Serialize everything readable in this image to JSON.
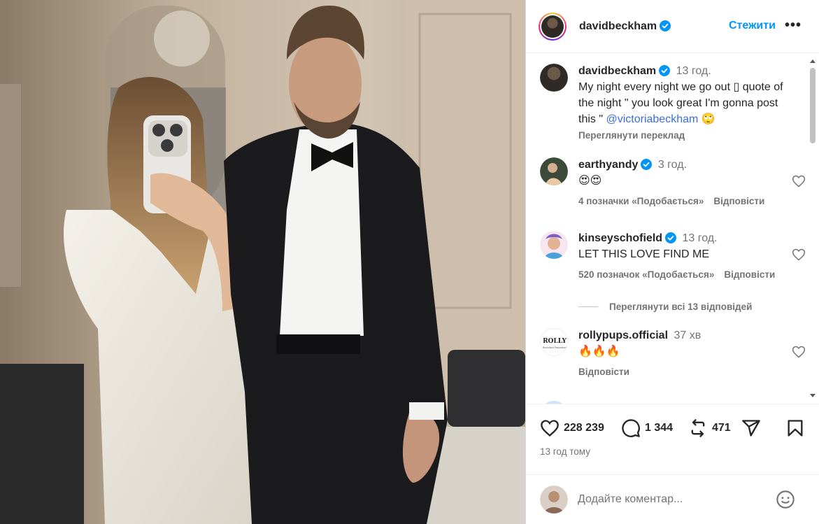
{
  "header": {
    "username": "davidbeckham",
    "follow_label": "Стежити",
    "more_label": "•••"
  },
  "caption": {
    "username": "davidbeckham",
    "time": "13 год.",
    "text": "My night every night we go out ▯ quote of the night \" you look great I'm gonna post this \" ",
    "mention": "@victoriabeckham",
    "emoji": "🙄",
    "translate_label": "Переглянути переклад"
  },
  "comments": [
    {
      "username": "earthyandy",
      "verified": true,
      "time": "3 год.",
      "text": "😍😍",
      "likes": "4 позначки «Подобається»",
      "reply": "Відповісти"
    },
    {
      "username": "kinseyschofield",
      "verified": true,
      "time": "13 год.",
      "text": "LET THIS LOVE FIND ME",
      "likes": "520 позначок «Подобається»",
      "reply": "Відповісти"
    },
    {
      "username": "rollypups.official",
      "verified": false,
      "time": "37 хв",
      "text": "🔥🔥🔥",
      "likes": "",
      "reply": "Відповісти"
    }
  ],
  "view_replies_label": "Переглянути всі 13 відповідей",
  "actions": {
    "likes": "228 239",
    "comments": "1 344",
    "reposts": "471"
  },
  "post_time": "13 год тому",
  "add_comment": {
    "placeholder": "Додайте коментар..."
  },
  "avatars": {
    "rollypups_text": "ROLLY",
    "rollypups_sub": "Recollect Paparazzi"
  },
  "colors": {
    "accent_blue": "#0095f6",
    "verified_blue": "#0095f6",
    "muted_text": "#737373"
  },
  "icons": [
    "verified-badge-icon",
    "more-options-icon",
    "heart-icon",
    "comment-icon",
    "repost-icon",
    "share-icon",
    "bookmark-icon",
    "emoji-icon"
  ]
}
